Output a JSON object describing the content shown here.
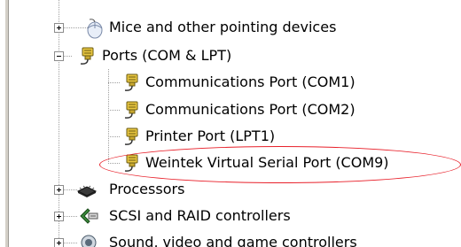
{
  "device_tree": {
    "items": [
      {
        "label": "Mice and other pointing devices",
        "icon": "mouse-icon",
        "expander": "plus"
      },
      {
        "label": "Ports (COM & LPT)",
        "icon": "port-connector-icon",
        "expander": "minus"
      },
      {
        "label": "Communications Port (COM1)",
        "icon": "port-connector-icon"
      },
      {
        "label": "Communications Port (COM2)",
        "icon": "port-connector-icon"
      },
      {
        "label": "Printer Port (LPT1)",
        "icon": "port-connector-icon"
      },
      {
        "label": "Weintek Virtual Serial Port (COM9)",
        "icon": "port-connector-icon",
        "highlighted": true
      },
      {
        "label": "Processors",
        "icon": "processor-chip-icon",
        "expander": "plus"
      },
      {
        "label": "SCSI and RAID controllers",
        "icon": "scsi-controller-icon",
        "expander": "plus"
      },
      {
        "label": "Sound, video and game controllers",
        "icon": "sound-speaker-icon",
        "expander": "plus"
      }
    ]
  },
  "colors": {
    "highlight_ellipse": "#e8202a",
    "tree_lines": "#a0a0a0",
    "port_icon_body": "#e8c640"
  }
}
